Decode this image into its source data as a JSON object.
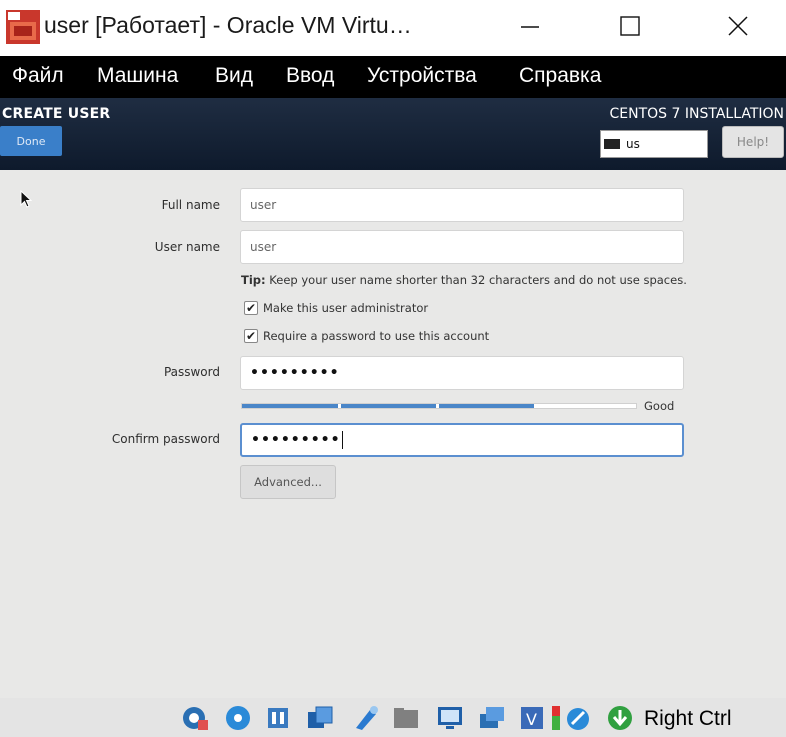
{
  "window": {
    "title": "user [Работает] - Oracle VM Virtu…",
    "icon": "virtualbox-icon"
  },
  "menu": {
    "items": [
      "Файл",
      "Машина",
      "Вид",
      "Ввод",
      "Устройства",
      "Справка"
    ]
  },
  "header": {
    "title": "CREATE USER",
    "done_label": "Done",
    "install_title": "CENTOS 7 INSTALLATION",
    "keyboard_layout": "us",
    "help_label": "Help!"
  },
  "form": {
    "fullname_label": "Full name",
    "fullname_value": "user",
    "username_label": "User name",
    "username_value": "user",
    "tip_bold": "Tip:",
    "tip_text": " Keep your user name shorter than 32 characters and do not use spaces.",
    "admin_checkbox_label": "Make this user administrator",
    "admin_checked": true,
    "require_password_label": "Require a password to use this account",
    "require_password_checked": true,
    "password_label": "Password",
    "password_value": "•••••••••",
    "strength_label": "Good",
    "strength_fraction": 0.75,
    "confirm_label": "Confirm password",
    "confirm_value": "•••••••••",
    "advanced_label": "Advanced..."
  },
  "statusbar": {
    "right_ctrl": "Right Ctrl",
    "icons": [
      "hard-disk-icon",
      "optical-drive-icon",
      "audio-icon",
      "network-icon",
      "usb-icon",
      "shared-folder-icon",
      "display-icon",
      "recording-icon",
      "virtualization-icon",
      "cpu-icon",
      "mouse-integration-icon",
      "host-key-icon"
    ]
  },
  "colors": {
    "header_bg": "#1a273a",
    "done_button": "#3a7fc9",
    "strength_bar": "#4a86c8",
    "content_bg": "#e8e8e7"
  }
}
